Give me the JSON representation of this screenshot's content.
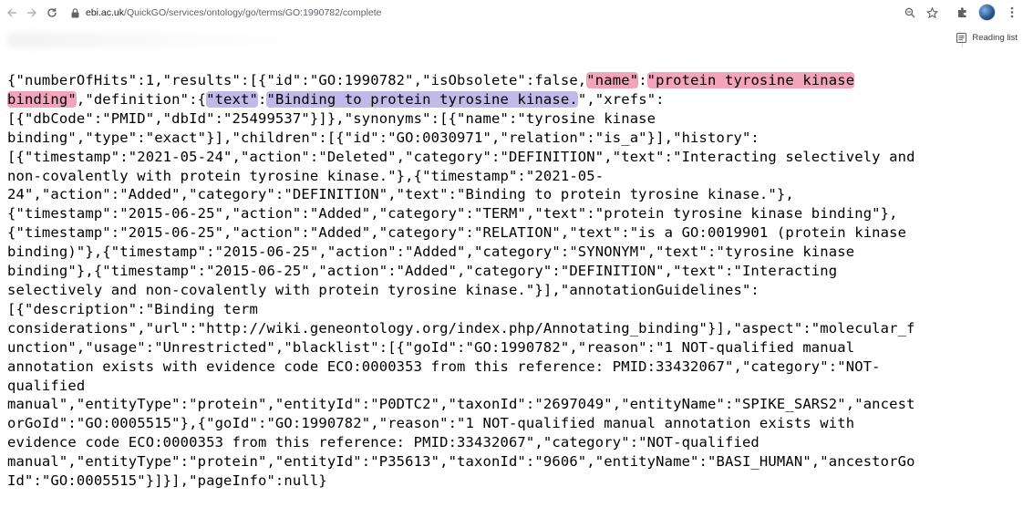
{
  "browser": {
    "url_host": "ebi.ac.uk",
    "url_path": "/QuickGO/services/ontology/go/terms/GO:1990782/complete",
    "reading_list_label": "Reading list",
    "icons": {
      "back": "arrow-left-icon",
      "forward": "arrow-right-icon",
      "reload": "reload-icon",
      "lock": "lock-icon",
      "zoom": "zoom-icon",
      "bookmark": "star-icon",
      "extensions": "puzzle-icon",
      "profile": "avatar",
      "menu": "kebab-menu-icon",
      "reading_list": "reading-list-icon"
    },
    "colors": {
      "highlight_name": "#ec6e96",
      "highlight_definition": "#a096dc"
    }
  },
  "json_text": {
    "l1a": "{\"numberOfHits\":1,\"results\":[{\"id\":\"GO:1990782\",\"isObsolete\":false,",
    "l1_name_key": "\"name\"",
    "l1_colon": ":",
    "l1_name_val_a": "\"protein tyrosine kinase",
    "l2_name_val_b": "binding\"",
    "l2b": ",\"definition\":{",
    "l2_text_key": "\"text\"",
    "l2_colon": ":",
    "l2_text_val": "\"Binding to protein tyrosine kinase.",
    "l2c": "\",\"xrefs\":",
    "l3": "[{\"dbCode\":\"PMID\",\"dbId\":\"25499537\"}]},\"synonyms\":[{\"name\":\"tyrosine kinase",
    "l4": "binding\",\"type\":\"exact\"}],\"children\":[{\"id\":\"GO:0030971\",\"relation\":\"is_a\"}],\"history\":",
    "l5": "[{\"timestamp\":\"2021-05-24\",\"action\":\"Deleted\",\"category\":\"DEFINITION\",\"text\":\"Interacting selectively and",
    "l6": "non-covalently with protein tyrosine kinase.\"},{\"timestamp\":\"2021-05-",
    "l7": "24\",\"action\":\"Added\",\"category\":\"DEFINITION\",\"text\":\"Binding to protein tyrosine kinase.\"},",
    "l8": "{\"timestamp\":\"2015-06-25\",\"action\":\"Added\",\"category\":\"TERM\",\"text\":\"protein tyrosine kinase binding\"},",
    "l9": "{\"timestamp\":\"2015-06-25\",\"action\":\"Added\",\"category\":\"RELATION\",\"text\":\"is a GO:0019901 (protein kinase",
    "l10": "binding)\"},{\"timestamp\":\"2015-06-25\",\"action\":\"Added\",\"category\":\"SYNONYM\",\"text\":\"tyrosine kinase",
    "l11": "binding\"},{\"timestamp\":\"2015-06-25\",\"action\":\"Added\",\"category\":\"DEFINITION\",\"text\":\"Interacting",
    "l12": "selectively and non-covalently with protein tyrosine kinase.\"}],\"annotationGuidelines\":",
    "l13": "[{\"description\":\"Binding term",
    "l14": "considerations\",\"url\":\"http://wiki.geneontology.org/index.php/Annotating_binding\"}],\"aspect\":\"molecular_f",
    "l15": "unction\",\"usage\":\"Unrestricted\",\"blacklist\":[{\"goId\":\"GO:1990782\",\"reason\":\"1 NOT-qualified manual",
    "l16": "annotation exists with evidence code ECO:0000353 from this reference: PMID:33432067\",\"category\":\"NOT-",
    "l17": "qualified",
    "l18": "manual\",\"entityType\":\"protein\",\"entityId\":\"P0DTC2\",\"taxonId\":\"2697049\",\"entityName\":\"SPIKE_SARS2\",\"ancest",
    "l19": "orGoId\":\"GO:0005515\"},{\"goId\":\"GO:1990782\",\"reason\":\"1 NOT-qualified manual annotation exists with",
    "l20": "evidence code ECO:0000353 from this reference: PMID:33432067\",\"category\":\"NOT-qualified",
    "l21": "manual\",\"entityType\":\"protein\",\"entityId\":\"P35613\",\"taxonId\":\"9606\",\"entityName\":\"BASI_HUMAN\",\"ancestorGo",
    "l22": "Id\":\"GO:0005515\"}]}],\"pageInfo\":null}"
  }
}
